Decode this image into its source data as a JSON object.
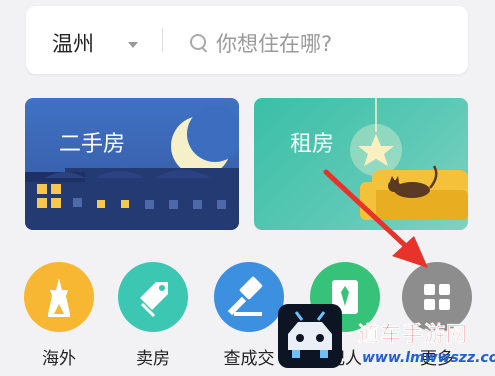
{
  "search": {
    "city": "温州",
    "placeholder": "你想住在哪?"
  },
  "cards": {
    "ershou": "二手房",
    "zufang": "租房"
  },
  "tiles": [
    {
      "label": "海外",
      "icon": "tower-icon",
      "color": "#f7b733"
    },
    {
      "label": "卖房",
      "icon": "tag-icon",
      "color": "#3cc7b3"
    },
    {
      "label": "查成交",
      "icon": "gavel-icon",
      "color": "#3d8fe0"
    },
    {
      "label": "纪人",
      "icon": "agent-id-icon",
      "color": "#37c27a"
    },
    {
      "label": "更多",
      "icon": "grid-icon",
      "color": "#8d8d8d"
    }
  ],
  "watermark": {
    "text": "道车手游网",
    "url": "www.lmwwszz.com"
  },
  "colors": {
    "annotation_arrow": "#e8332a"
  }
}
